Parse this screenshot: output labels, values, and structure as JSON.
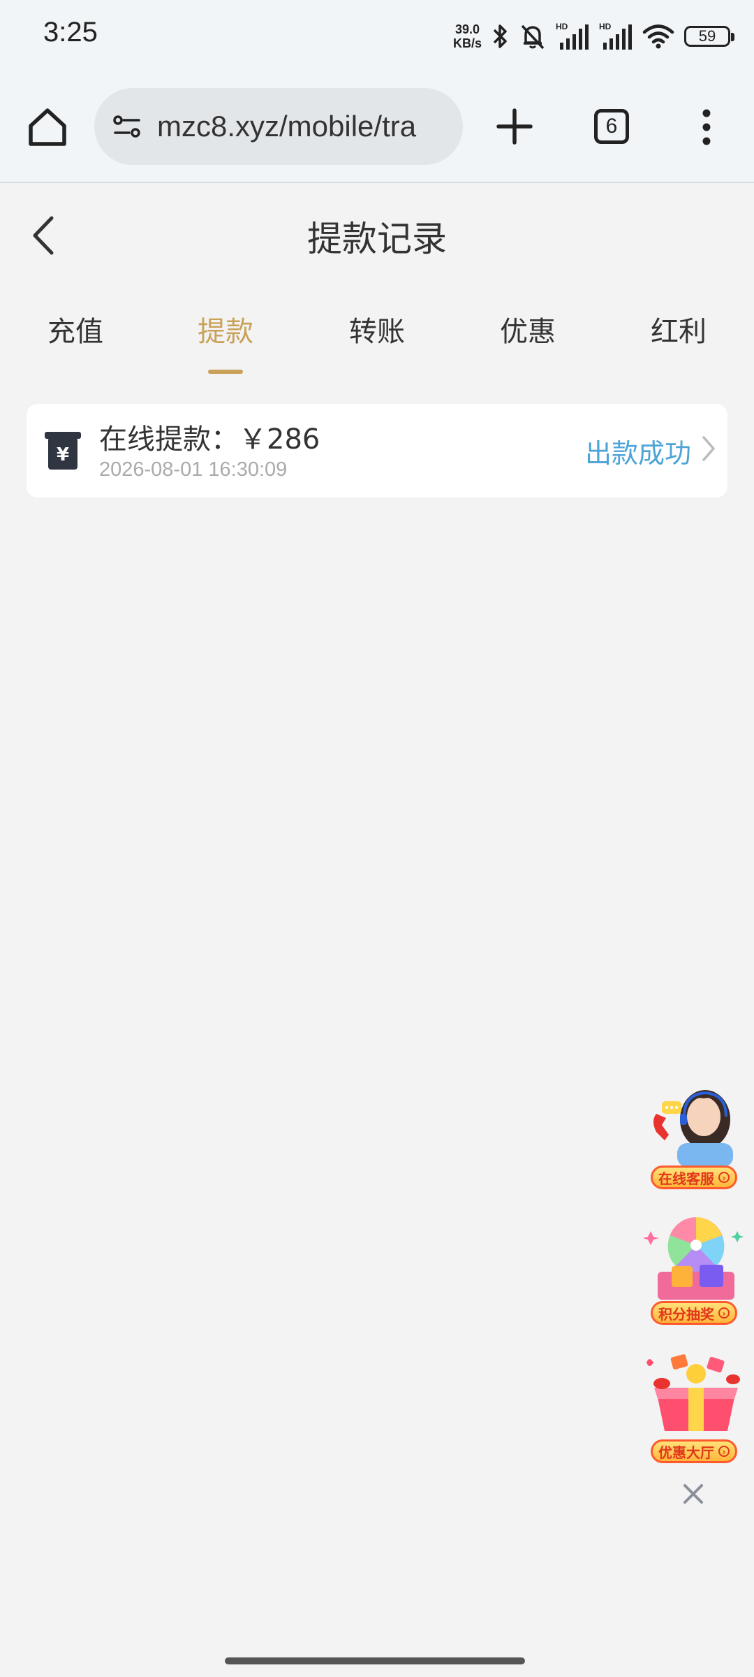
{
  "status_bar": {
    "time": "3:25",
    "net_speed_value": "39.0",
    "net_speed_unit": "KB/s",
    "battery": "59",
    "icons": [
      "bluetooth-icon",
      "mute-icon",
      "signal-icon",
      "signal-icon",
      "wifi-icon",
      "battery-icon"
    ]
  },
  "browser": {
    "url": "mzc8.xyz/mobile/tra",
    "tab_count": "6",
    "icons": [
      "home-icon",
      "site-settings-icon",
      "plus-icon",
      "tabs-icon",
      "more-vert-icon"
    ]
  },
  "page": {
    "title": "提款记录",
    "back_icon": "chevron-left-icon"
  },
  "tabs": [
    {
      "label": "充值"
    },
    {
      "label": "提款"
    },
    {
      "label": "转账"
    },
    {
      "label": "优惠"
    },
    {
      "label": "红利"
    }
  ],
  "active_tab": "提款",
  "records": [
    {
      "title": "在线提款：￥286",
      "time": "2026-08-01 16:30:09",
      "status": "出款成功",
      "icon": "withdraw-yen-icon"
    }
  ],
  "floating": [
    {
      "label": "在线客服"
    },
    {
      "label": "积分抽奖"
    },
    {
      "label": "优惠大厅"
    }
  ],
  "colors": {
    "accent": "#c9a158",
    "status_success": "#4da4d6",
    "background": "#f3f3f3"
  }
}
